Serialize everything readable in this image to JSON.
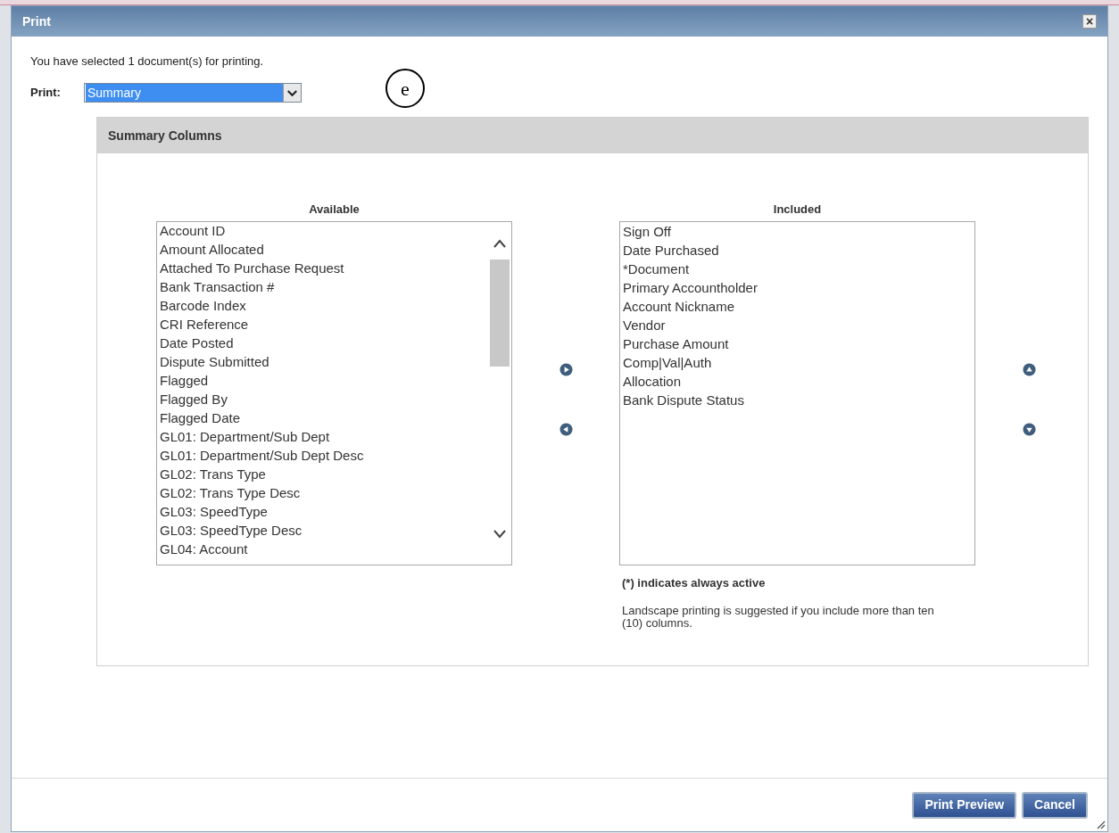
{
  "window": {
    "title": "Print",
    "close": "×"
  },
  "message": "You have selected 1 document(s) for printing.",
  "print_select": {
    "label": "Print:",
    "value": "Summary"
  },
  "callout": "e",
  "panel": {
    "title": "Summary Columns",
    "available": {
      "heading": "Available",
      "items": [
        "Account ID",
        "Amount Allocated",
        "Attached To Purchase Request",
        "Bank Transaction #",
        "Barcode Index",
        "CRI Reference",
        "Date Posted",
        "Dispute Submitted",
        "Flagged",
        "Flagged By",
        "Flagged Date",
        "GL01: Department/Sub Dept",
        "GL01: Department/Sub Dept Desc",
        "GL02: Trans Type",
        "GL02: Trans Type Desc",
        "GL03: SpeedType",
        "GL03: SpeedType Desc",
        "GL04: Account"
      ]
    },
    "included": {
      "heading": "Included",
      "items": [
        "Sign Off",
        "Date Purchased",
        "*Document",
        "Primary Accountholder",
        "Account Nickname",
        "Vendor",
        "Purchase Amount",
        "Comp|Val|Auth",
        "Allocation",
        "Bank Dispute Status"
      ]
    },
    "note": "(*) indicates always active",
    "hint": "Landscape printing is suggested if you include more than ten (10) columns."
  },
  "buttons": [
    "Print Preview",
    "Cancel"
  ]
}
